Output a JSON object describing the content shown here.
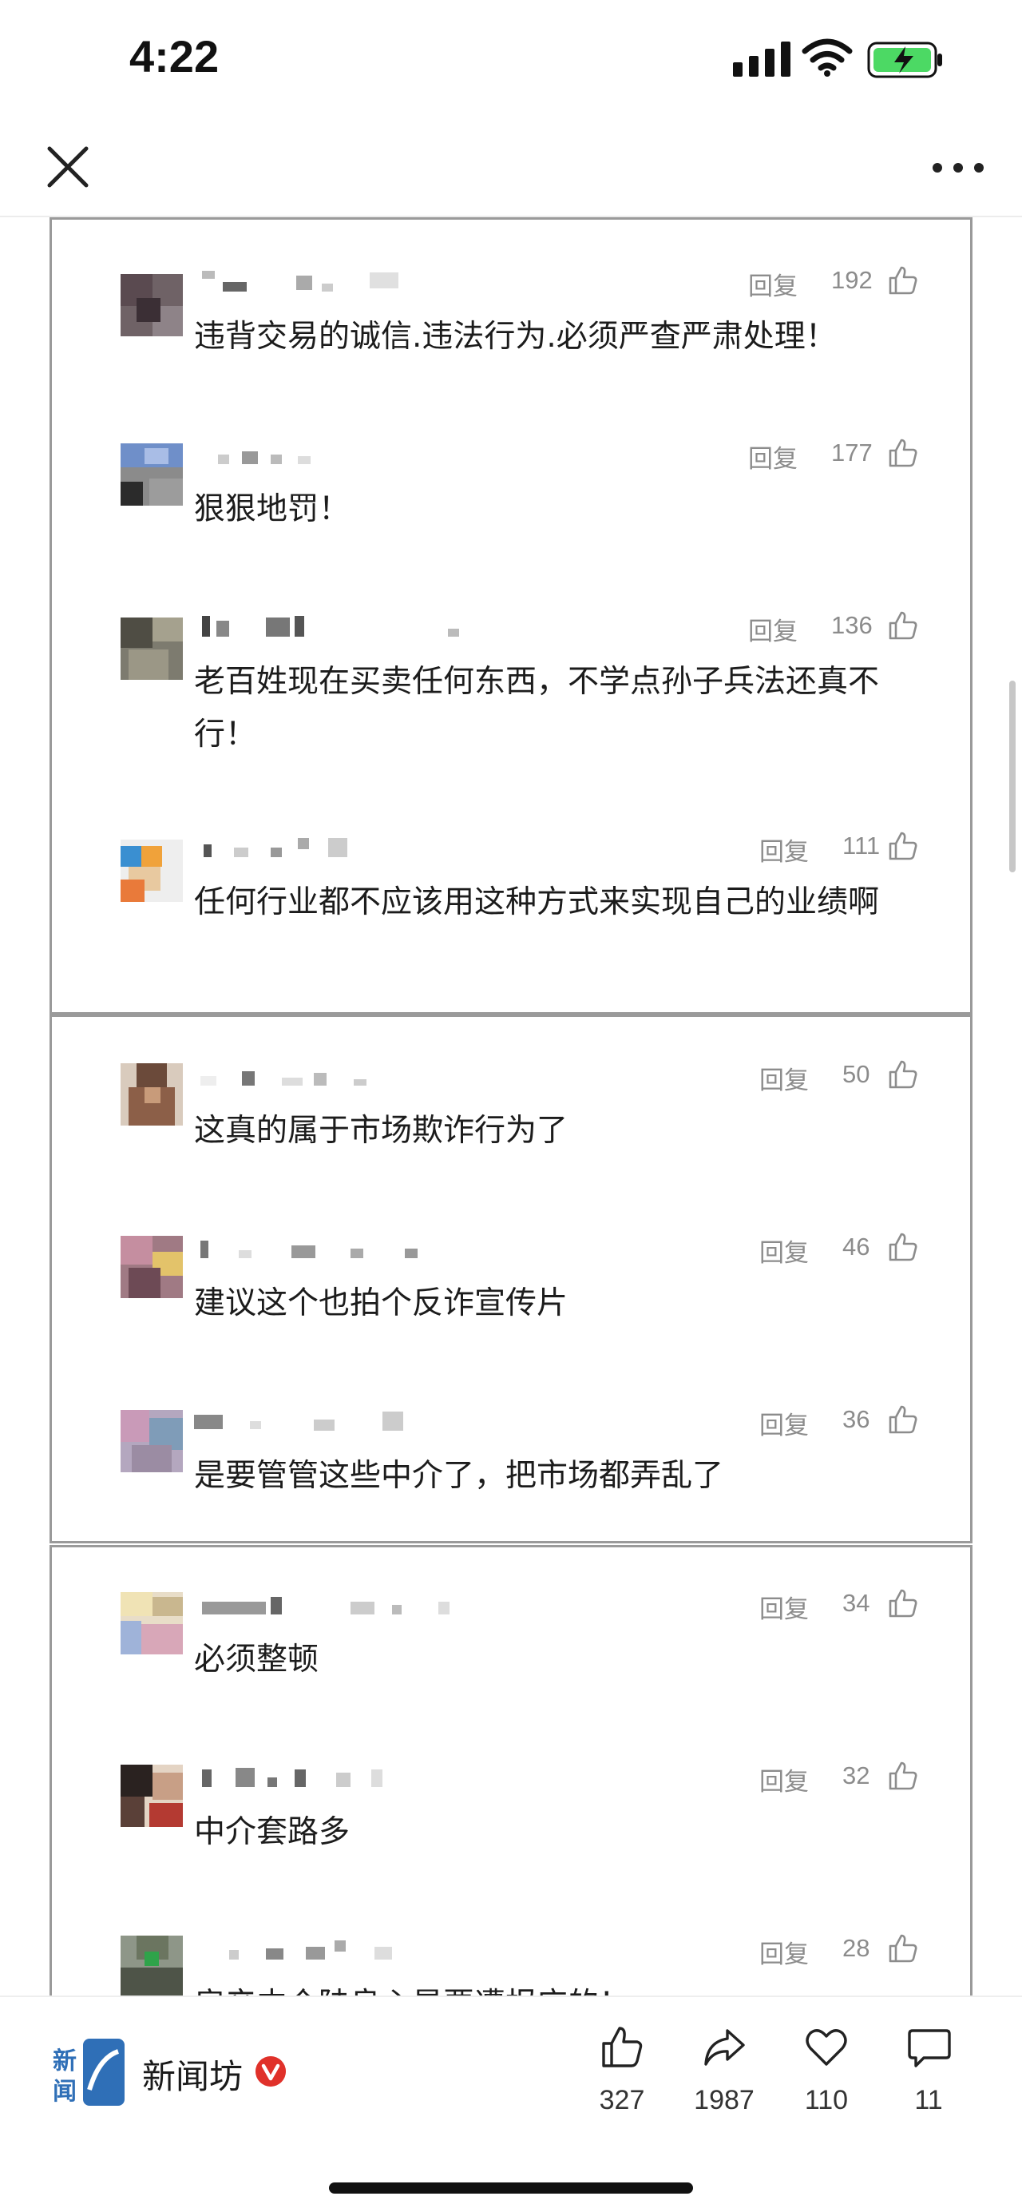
{
  "status_bar": {
    "time": "4:22"
  },
  "header": {
    "close_icon": "close-icon",
    "more_icon": "more-horizontal-icon"
  },
  "comments": [
    {
      "reply": "回复",
      "likes": "192",
      "text": "违背交易的诚信.违法行为.必须严查严肃处理！"
    },
    {
      "reply": "回复",
      "likes": "177",
      "text": "狠狠地罚！"
    },
    {
      "reply": "回复",
      "likes": "136",
      "text": "老百姓现在买卖任何东西，不学点孙子兵法还真不行！"
    },
    {
      "reply": "回复",
      "likes": "111",
      "text": "任何行业都不应该用这种方式来实现自己的业绩啊"
    },
    {
      "reply": "回复",
      "likes": "50",
      "text": "这真的属于市场欺诈行为了"
    },
    {
      "reply": "回复",
      "likes": "46",
      "text": "建议这个也拍个反诈宣传片"
    },
    {
      "reply": "回复",
      "likes": "36",
      "text": "是要管管这些中介了，把市场都弄乱了"
    },
    {
      "reply": "回复",
      "likes": "34",
      "text": "必须整顿"
    },
    {
      "reply": "回复",
      "likes": "32",
      "text": "中介套路多"
    },
    {
      "reply": "回复",
      "likes": "28",
      "text": "房产中介陆良心是要遭报应的！"
    }
  ],
  "bottom_bar": {
    "account_name": "新闻坊",
    "logo_text": "新闻坊",
    "like_count": "327",
    "share_count": "1987",
    "favorite_count": "110",
    "comment_count": "11"
  },
  "colors": {
    "verified": "#e0312a",
    "meta_gray": "#8c8c8c",
    "panel_border": "#9a9a9a"
  }
}
